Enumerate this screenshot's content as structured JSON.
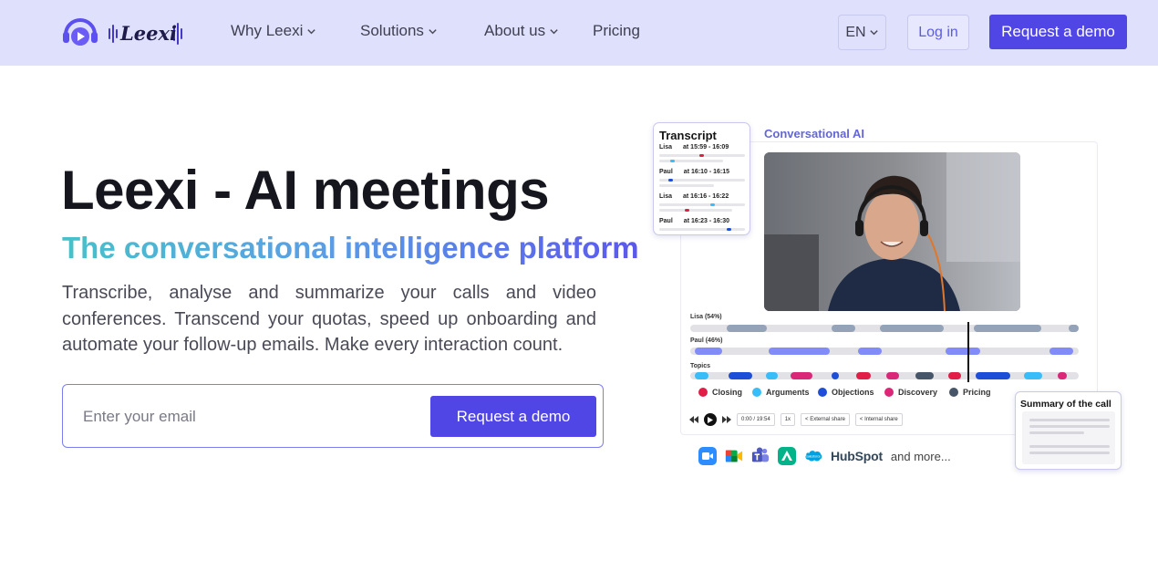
{
  "header": {
    "brand": "Leexi",
    "nav": [
      {
        "label": "Why Leexi",
        "has_dropdown": true
      },
      {
        "label": "Solutions",
        "has_dropdown": true
      },
      {
        "label": "About us",
        "has_dropdown": true
      },
      {
        "label": "Pricing",
        "has_dropdown": false
      }
    ],
    "language": "EN",
    "login_label": "Log in",
    "demo_label": "Request a demo"
  },
  "hero": {
    "title": "Leexi - AI meetings",
    "subtitle": "The conversational intelligence platform",
    "description": "Transcribe, analyse and summarize your calls and video conferences. Transcend your quotas, speed up onboarding and automate your follow-up emails. Make every interaction count.",
    "email_placeholder": "Enter your email",
    "cta_label": "Request a demo"
  },
  "illustration": {
    "section_label": "Conversational AI",
    "transcript": {
      "title": "Transcript",
      "entries": [
        {
          "speaker": "Lisa",
          "time": "at 15:59 - 16:09"
        },
        {
          "speaker": "Paul",
          "time": "at 16:10 - 16:15"
        },
        {
          "speaker": "Lisa",
          "time": "at 16:16 - 16:22"
        },
        {
          "speaker": "Paul",
          "time": "at 16:23 - 16:30"
        }
      ]
    },
    "speakers": [
      {
        "label": "Lisa (54%)"
      },
      {
        "label": "Paul (46%)"
      }
    ],
    "topics_label": "Topics",
    "legend": [
      {
        "label": "Closing",
        "color": "#e11d48"
      },
      {
        "label": "Arguments",
        "color": "#38bdf8"
      },
      {
        "label": "Objections",
        "color": "#1d4ed8"
      },
      {
        "label": "Discovery",
        "color": "#db2777"
      },
      {
        "label": "Pricing",
        "color": "#475569"
      }
    ],
    "player": {
      "time": "0:00 / 19:54",
      "speed": "1x",
      "external_share": "External share",
      "internal_share": "Internal share"
    },
    "summary_title": "Summary of the call",
    "integrations": [
      "zoom",
      "google-meet",
      "teams",
      "aircall",
      "salesforce"
    ],
    "hubspot_label": "HubSpot",
    "more_label": "and more..."
  }
}
